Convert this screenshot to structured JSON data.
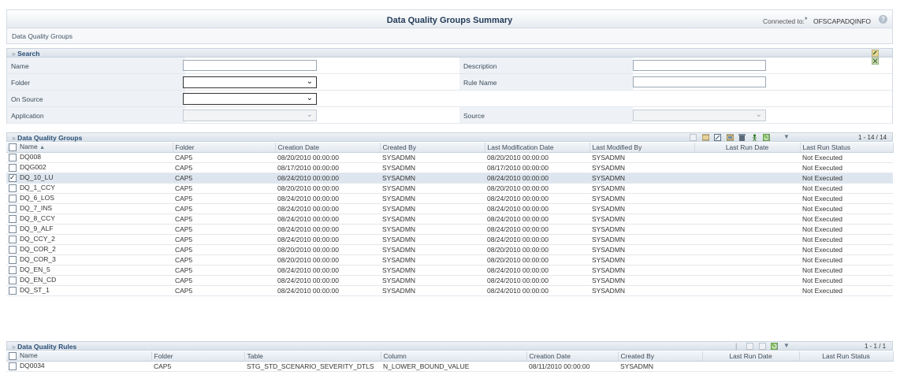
{
  "header": {
    "title": "Data Quality Groups Summary",
    "connected_label": "Connected to:",
    "connected_star": "*",
    "connected_value": "OFSCAPADQINFO"
  },
  "breadcrumb": "Data Quality Groups",
  "search": {
    "section_title": "Search",
    "name_label": "Name",
    "name_value": "",
    "description_label": "Description",
    "description_value": "",
    "folder_label": "Folder",
    "folder_value": "",
    "rule_name_label": "Rule Name",
    "rule_name_value": "",
    "on_source_label": "On Source",
    "on_source_value": "",
    "application_label": "Application",
    "application_value": "",
    "source_label": "Source",
    "source_value": ""
  },
  "groups": {
    "section_title": "Data Quality Groups",
    "pager": "1 - 14 / 14",
    "columns": [
      "Name",
      "Folder",
      "Creation Date",
      "Created By",
      "Last Modification Date",
      "Last Modified By",
      "Last Run Date",
      "Last Run Status"
    ],
    "sort_indicator": "▲",
    "rows": [
      {
        "name": "DQ008",
        "folder": "CAP5",
        "created": "08/20/2010 00:00:00",
        "created_by": "SYSADMN",
        "modified": "08/20/2010 00:00:00",
        "modified_by": "SYSADMN",
        "run_date": "",
        "status": "Not Executed",
        "checked": false
      },
      {
        "name": "DQG002",
        "folder": "CAP5",
        "created": "08/17/2010 00:00:00",
        "created_by": "SYSADMN",
        "modified": "08/17/2010 00:00:00",
        "modified_by": "SYSADMN",
        "run_date": "",
        "status": "Not Executed",
        "checked": false
      },
      {
        "name": "DQ_10_LU",
        "folder": "CAP5",
        "created": "08/24/2010 00:00:00",
        "created_by": "SYSADMN",
        "modified": "08/24/2010 00:00:00",
        "modified_by": "SYSADMN",
        "run_date": "",
        "status": "Not Executed",
        "checked": true
      },
      {
        "name": "DQ_1_CCY",
        "folder": "CAP5",
        "created": "08/20/2010 00:00:00",
        "created_by": "SYSADMN",
        "modified": "08/20/2010 00:00:00",
        "modified_by": "SYSADMN",
        "run_date": "",
        "status": "Not Executed",
        "checked": false
      },
      {
        "name": "DQ_6_LOS",
        "folder": "CAP5",
        "created": "08/24/2010 00:00:00",
        "created_by": "SYSADMN",
        "modified": "08/24/2010 00:00:00",
        "modified_by": "SYSADMN",
        "run_date": "",
        "status": "Not Executed",
        "checked": false
      },
      {
        "name": "DQ_7_INS",
        "folder": "CAP5",
        "created": "08/24/2010 00:00:00",
        "created_by": "SYSADMN",
        "modified": "08/24/2010 00:00:00",
        "modified_by": "SYSADMN",
        "run_date": "",
        "status": "Not Executed",
        "checked": false
      },
      {
        "name": "DQ_8_CCY",
        "folder": "CAP5",
        "created": "08/24/2010 00:00:00",
        "created_by": "SYSADMN",
        "modified": "08/24/2010 00:00:00",
        "modified_by": "SYSADMN",
        "run_date": "",
        "status": "Not Executed",
        "checked": false
      },
      {
        "name": "DQ_9_ALF",
        "folder": "CAP5",
        "created": "08/24/2010 00:00:00",
        "created_by": "SYSADMN",
        "modified": "08/24/2010 00:00:00",
        "modified_by": "SYSADMN",
        "run_date": "",
        "status": "Not Executed",
        "checked": false
      },
      {
        "name": "DQ_CCY_2",
        "folder": "CAP5",
        "created": "08/24/2010 00:00:00",
        "created_by": "SYSADMN",
        "modified": "08/24/2010 00:00:00",
        "modified_by": "SYSADMN",
        "run_date": "",
        "status": "Not Executed",
        "checked": false
      },
      {
        "name": "DQ_COR_2",
        "folder": "CAP5",
        "created": "08/20/2010 00:00:00",
        "created_by": "SYSADMN",
        "modified": "08/20/2010 00:00:00",
        "modified_by": "SYSADMN",
        "run_date": "",
        "status": "Not Executed",
        "checked": false
      },
      {
        "name": "DQ_COR_3",
        "folder": "CAP5",
        "created": "08/20/2010 00:00:00",
        "created_by": "SYSADMN",
        "modified": "08/20/2010 00:00:00",
        "modified_by": "SYSADMN",
        "run_date": "",
        "status": "Not Executed",
        "checked": false
      },
      {
        "name": "DQ_EN_5",
        "folder": "CAP5",
        "created": "08/24/2010 00:00:00",
        "created_by": "SYSADMN",
        "modified": "08/24/2010 00:00:00",
        "modified_by": "SYSADMN",
        "run_date": "",
        "status": "Not Executed",
        "checked": false
      },
      {
        "name": "DQ_EN_CD",
        "folder": "CAP5",
        "created": "08/24/2010 00:00:00",
        "created_by": "SYSADMN",
        "modified": "08/24/2010 00:00:00",
        "modified_by": "SYSADMN",
        "run_date": "",
        "status": "Not Executed",
        "checked": false
      },
      {
        "name": "DQ_ST_1",
        "folder": "CAP5",
        "created": "08/24/2010 00:00:00",
        "created_by": "SYSADMN",
        "modified": "08/24/2010 00:00:00",
        "modified_by": "SYSADMN",
        "run_date": "",
        "status": "Not Executed",
        "checked": false
      }
    ]
  },
  "rules": {
    "section_title": "Data Quality Rules",
    "pager": "1 - 1 / 1",
    "columns": [
      "Name",
      "Folder",
      "Table",
      "Column",
      "Creation Date",
      "Created By",
      "Last Run Date",
      "Last Run Status"
    ],
    "rows": [
      {
        "name": "DQ0034",
        "folder": "CAP5",
        "table": "STG_STD_SCENARIO_SEVERITY_DTLS",
        "column": "N_LOWER_BOUND_VALUE",
        "created": "08/11/2010 00:00:00",
        "created_by": "SYSADMN",
        "run_date": "",
        "status": ""
      }
    ]
  },
  "colors": {
    "title_text": "#233c59",
    "section_title": "#2a4e75",
    "selected_row": "#dde6ef"
  }
}
